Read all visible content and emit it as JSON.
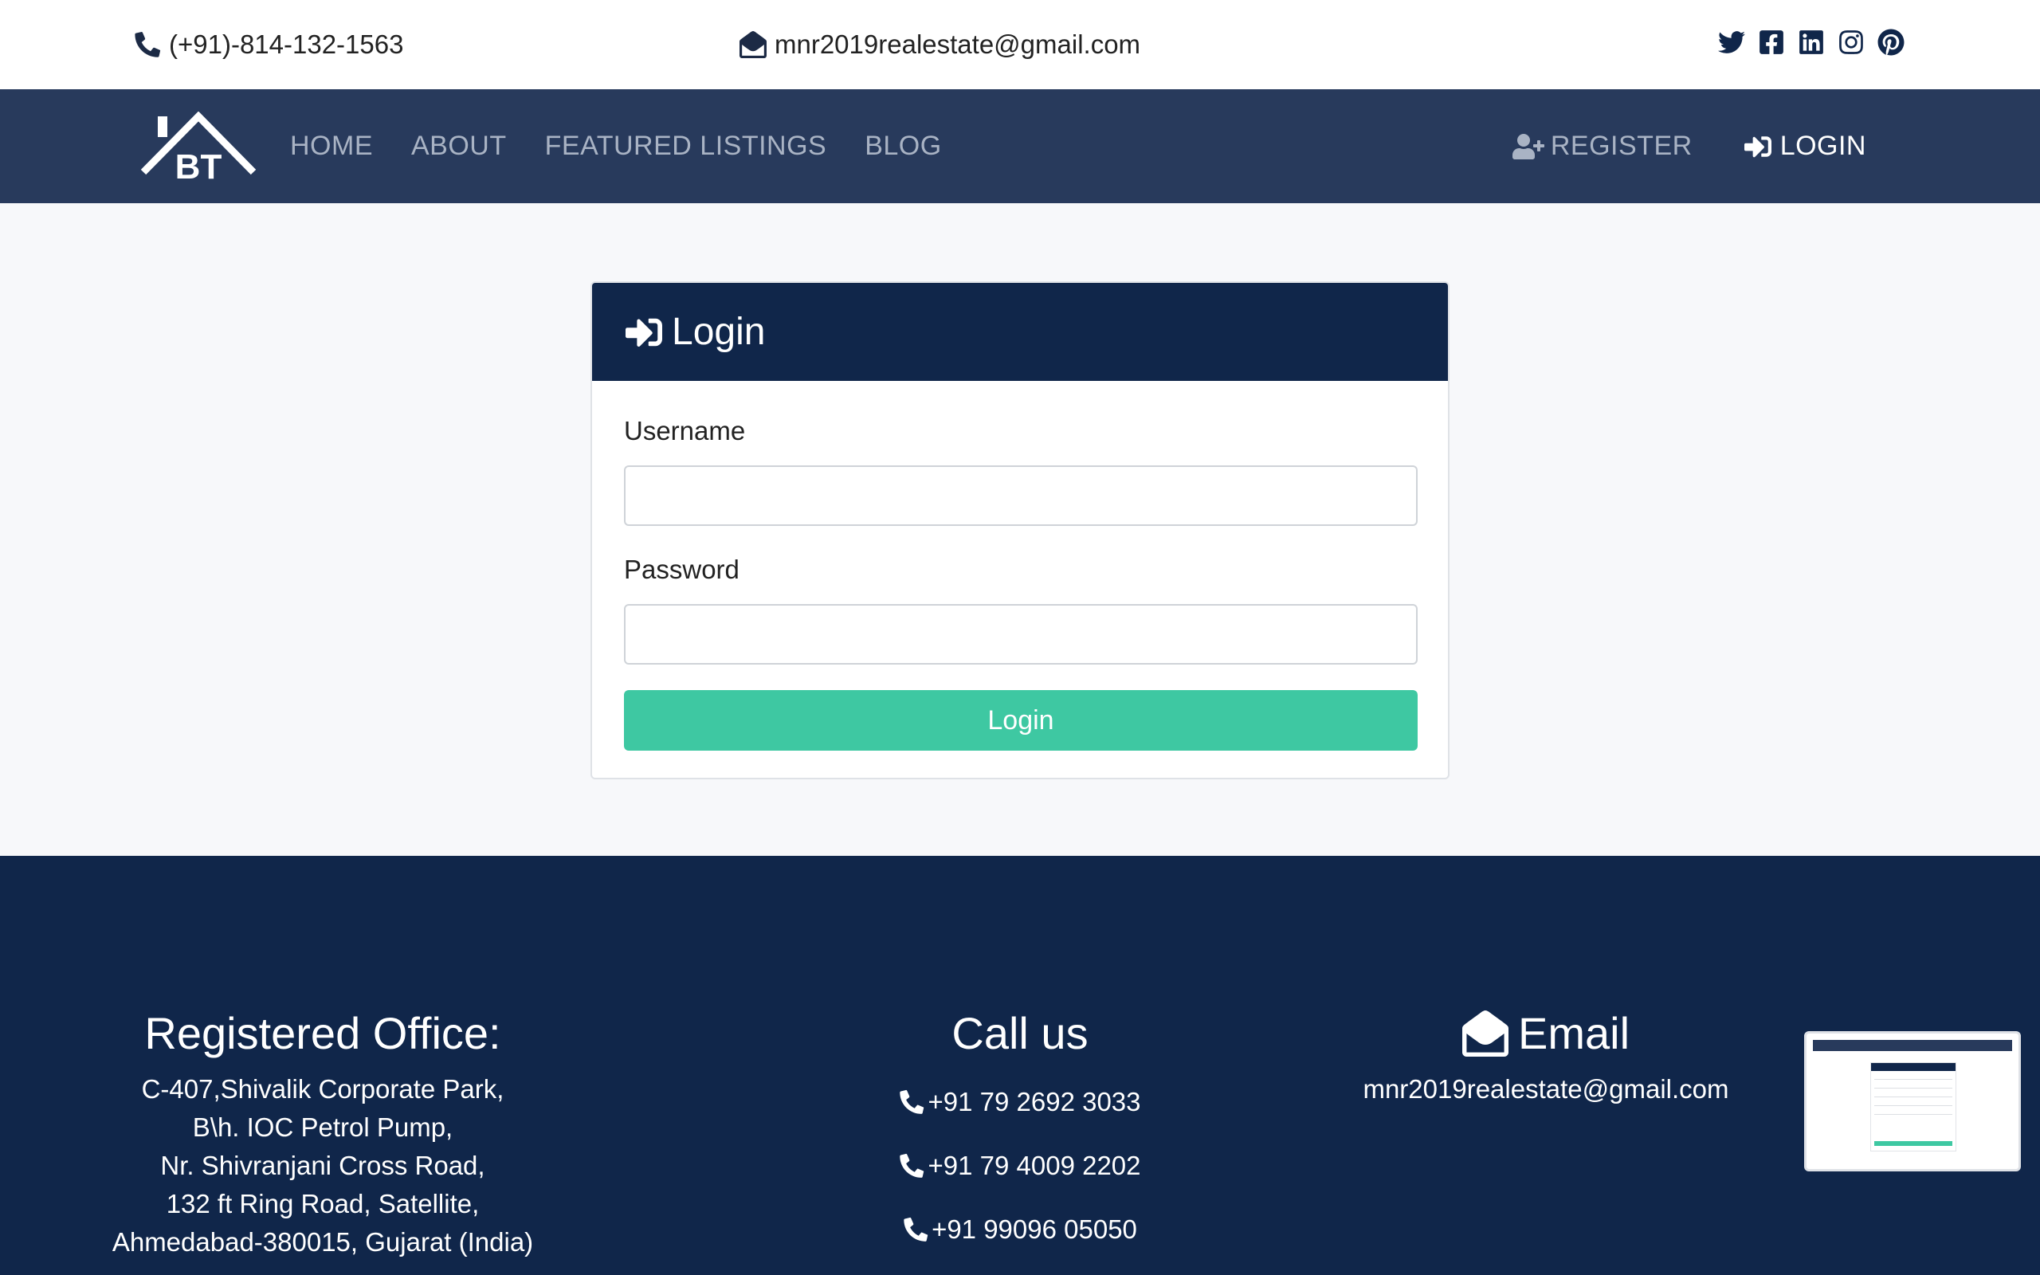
{
  "topbar": {
    "phone": "(+91)-814-132-1563",
    "email": "mnr2019realestate@gmail.com",
    "social_icons": [
      "twitter-icon",
      "facebook-icon",
      "linkedin-icon",
      "instagram-icon",
      "pinterest-icon"
    ]
  },
  "navbar": {
    "logo_text": "BT",
    "links": [
      "HOME",
      "ABOUT",
      "FEATURED LISTINGS",
      "BLOG"
    ],
    "register": "REGISTER",
    "login": "LOGIN"
  },
  "login_card": {
    "title": "Login",
    "username_label": "Username",
    "username_value": "",
    "password_label": "Password",
    "password_value": "",
    "submit_label": "Login"
  },
  "footer": {
    "office_title": "Registered Office:",
    "office_lines": [
      "C-407,Shivalik Corporate Park,",
      "B\\h. IOC Petrol Pump,",
      "Nr. Shivranjani Cross Road,",
      "132 ft Ring Road, Satellite,",
      "Ahmedabad-380015, Gujarat (India)"
    ],
    "call_title": "Call us",
    "phones": [
      "+91 79 2692 3033",
      "+91 79 4009 2202",
      "+91 99096 05050"
    ],
    "email_title": "Email",
    "email": "mnr2019realestate@gmail.com"
  },
  "colors": {
    "navbar": "#283a5c",
    "dark_navy": "#10264a",
    "accent_green": "#3ec8a2",
    "nav_link": "#a9b3c4"
  }
}
